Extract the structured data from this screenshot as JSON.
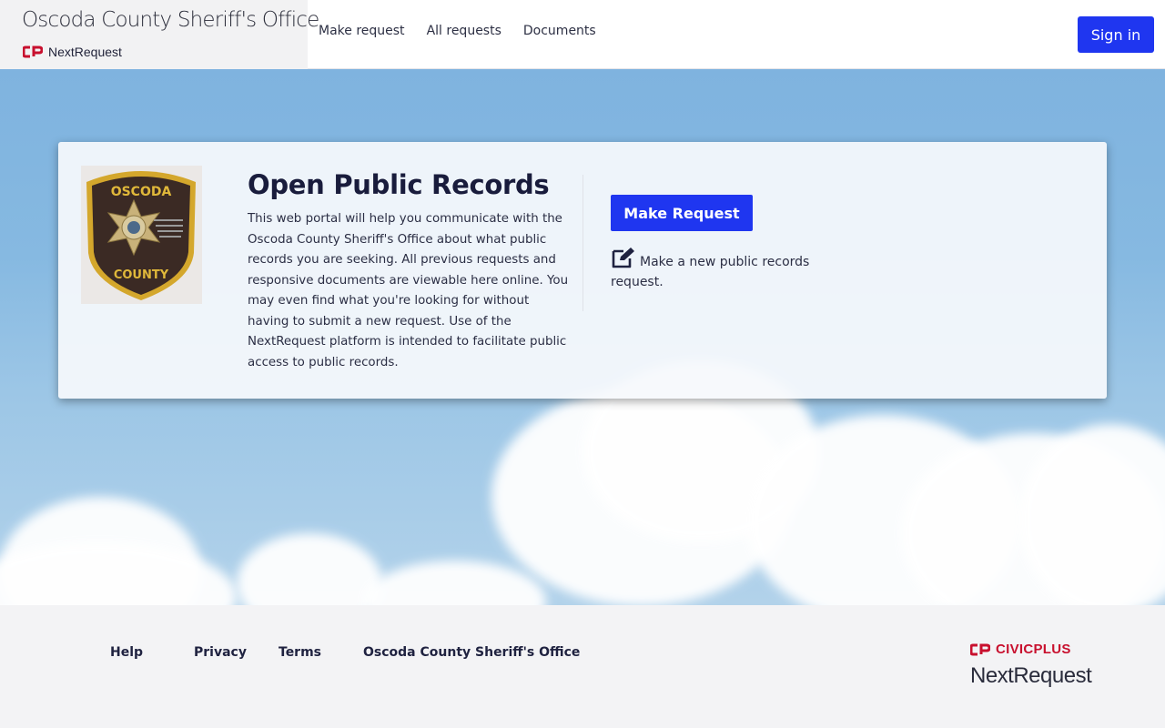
{
  "header": {
    "brand_title": "Oscoda County Sheriff's Office",
    "brand_sub": "NextRequest",
    "nav": [
      "Make request",
      "All requests",
      "Documents"
    ],
    "sign_in": "Sign in"
  },
  "hero": {
    "badge_text_top": "OSCODA",
    "badge_text_bottom": "COUNTY",
    "title": "Open Public Records",
    "description": "This web portal will help you communicate with the Oscoda County Sheriff's Office about what public records you are seeking. All previous requests and responsive documents are viewable here online. You may even find what you're looking for without having to submit a new request. Use of the NextRequest platform is intended to facilitate public access to public records.",
    "make_request_button": "Make Request",
    "make_request_hint": "Make a new public records request.",
    "icons": {
      "edit": "edit-icon",
      "badge": "sheriff-badge"
    }
  },
  "footer": {
    "links": [
      "Help",
      "Privacy",
      "Terms",
      "Oscoda County Sheriff's Office"
    ],
    "civic_brand": "CIVICPLUS",
    "civic_product": "NextRequest"
  },
  "colors": {
    "accent": "#1f36f0",
    "brand_red": "#c8102e",
    "text_dark": "#1f2240"
  }
}
